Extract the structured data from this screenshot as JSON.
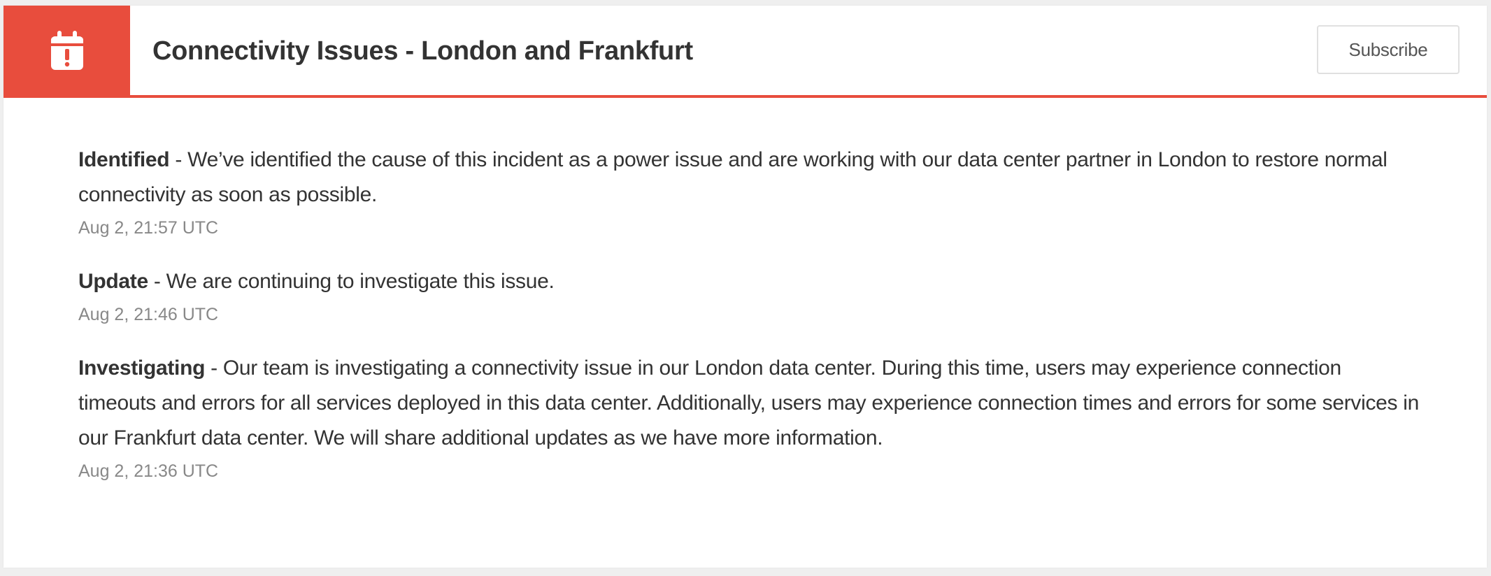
{
  "incident": {
    "title": "Connectivity Issues - London and Frankfurt",
    "icon": "calendar-alert-icon",
    "subscribe_label": "Subscribe"
  },
  "colors": {
    "accent": "#e84d3d",
    "text": "#333333",
    "muted": "#888888"
  },
  "updates": [
    {
      "status": "Identified",
      "separator": " - ",
      "message": "We’ve identified the cause of this incident as a power issue and are working with our data center partner in London to restore normal connectivity as soon as possible.",
      "timestamp": "Aug 2, 21:57 UTC"
    },
    {
      "status": "Update",
      "separator": " - ",
      "message": "We are continuing to investigate this issue.",
      "timestamp": "Aug 2, 21:46 UTC"
    },
    {
      "status": "Investigating",
      "separator": " - ",
      "message": "Our team is investigating a connectivity issue in our London data center. During this time, users may experience connection timeouts and errors for all services deployed in this data center. Additionally, users may experience connection times and errors for some services in our Frankfurt data center. We will share additional updates as we have more information.",
      "timestamp": "Aug 2, 21:36 UTC"
    }
  ]
}
